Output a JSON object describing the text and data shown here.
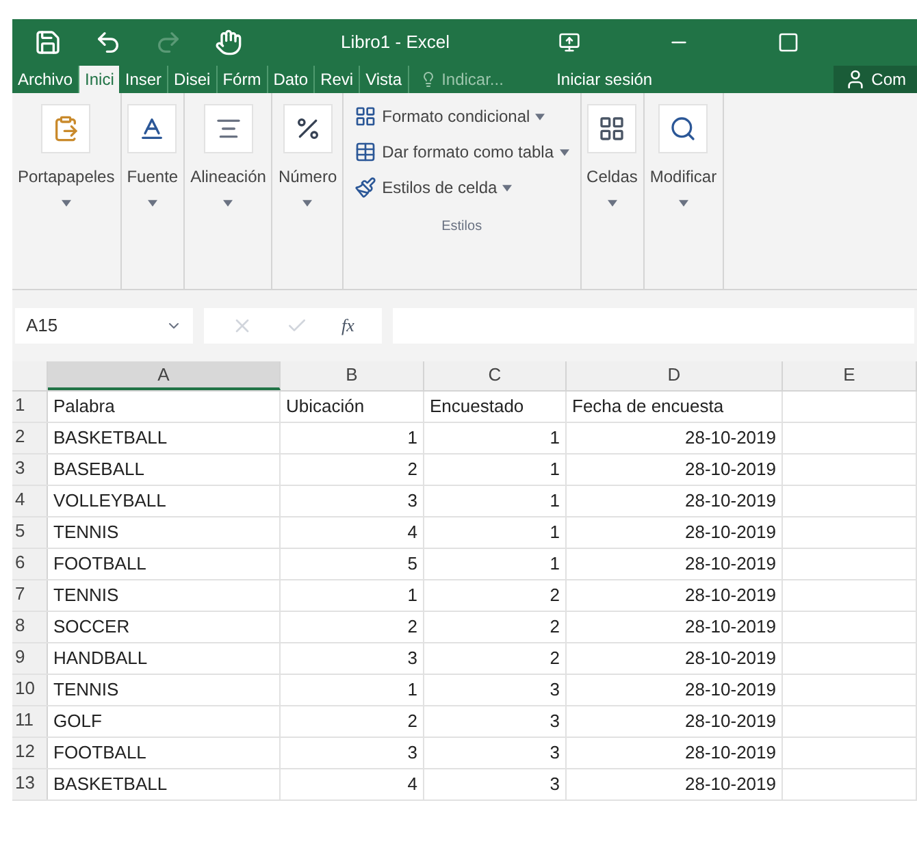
{
  "window": {
    "title": "Libro1 - Excel"
  },
  "tabs": [
    {
      "label": "Archivo",
      "selected": false
    },
    {
      "label": "Inici",
      "selected": true
    },
    {
      "label": "Inser",
      "selected": false
    },
    {
      "label": "Disei",
      "selected": false
    },
    {
      "label": "Fórm",
      "selected": false
    },
    {
      "label": "Dato",
      "selected": false
    },
    {
      "label": "Revi",
      "selected": false
    },
    {
      "label": "Vista",
      "selected": false
    }
  ],
  "tell_me": {
    "placeholder": "Indicar..."
  },
  "sign_in": "Iniciar sesión",
  "share": "Com",
  "ribbon": {
    "groups": [
      {
        "kind": "big",
        "label": "Portapapeles"
      },
      {
        "kind": "big",
        "label": "Fuente"
      },
      {
        "kind": "big",
        "label": "Alineación"
      },
      {
        "kind": "big",
        "label": "Número"
      },
      {
        "kind": "styles",
        "label": "Estilos",
        "items": [
          "Formato condicional",
          "Dar formato como tabla",
          "Estilos de celda"
        ]
      },
      {
        "kind": "big",
        "label": "Celdas"
      },
      {
        "kind": "big",
        "label": "Modificar"
      }
    ]
  },
  "name_box": "A15",
  "function_button": "fx",
  "columns": [
    "A",
    "B",
    "C",
    "D",
    "E"
  ],
  "rows": [
    {
      "n": "1",
      "cells": [
        "Palabra",
        "Ubicación",
        "Encuestado",
        "Fecha de encuesta"
      ],
      "header": true
    },
    {
      "n": "2",
      "cells": [
        "BASKETBALL",
        "1",
        "1",
        "28-10-2019"
      ],
      "header": false
    },
    {
      "n": "3",
      "cells": [
        "BASEBALL",
        "2",
        "1",
        "28-10-2019"
      ],
      "header": false
    },
    {
      "n": "4",
      "cells": [
        "VOLLEYBALL",
        "3",
        "1",
        "28-10-2019"
      ],
      "header": false
    },
    {
      "n": "5",
      "cells": [
        "TENNIS",
        "4",
        "1",
        "28-10-2019"
      ],
      "header": false
    },
    {
      "n": "6",
      "cells": [
        "FOOTBALL",
        "5",
        "1",
        "28-10-2019"
      ],
      "header": false
    },
    {
      "n": "7",
      "cells": [
        "TENNIS",
        "1",
        "2",
        "28-10-2019"
      ],
      "header": false
    },
    {
      "n": "8",
      "cells": [
        "SOCCER",
        "2",
        "2",
        "28-10-2019"
      ],
      "header": false
    },
    {
      "n": "9",
      "cells": [
        "HANDBALL",
        "3",
        "2",
        "28-10-2019"
      ],
      "header": false
    },
    {
      "n": "10",
      "cells": [
        "TENNIS",
        "1",
        "3",
        "28-10-2019"
      ],
      "header": false
    },
    {
      "n": "11",
      "cells": [
        "GOLF",
        "2",
        "3",
        "28-10-2019"
      ],
      "header": false
    },
    {
      "n": "12",
      "cells": [
        "FOOTBALL",
        "3",
        "3",
        "28-10-2019"
      ],
      "header": false
    },
    {
      "n": "13",
      "cells": [
        "BASKETBALL",
        "4",
        "3",
        "28-10-2019"
      ],
      "header": false
    }
  ]
}
